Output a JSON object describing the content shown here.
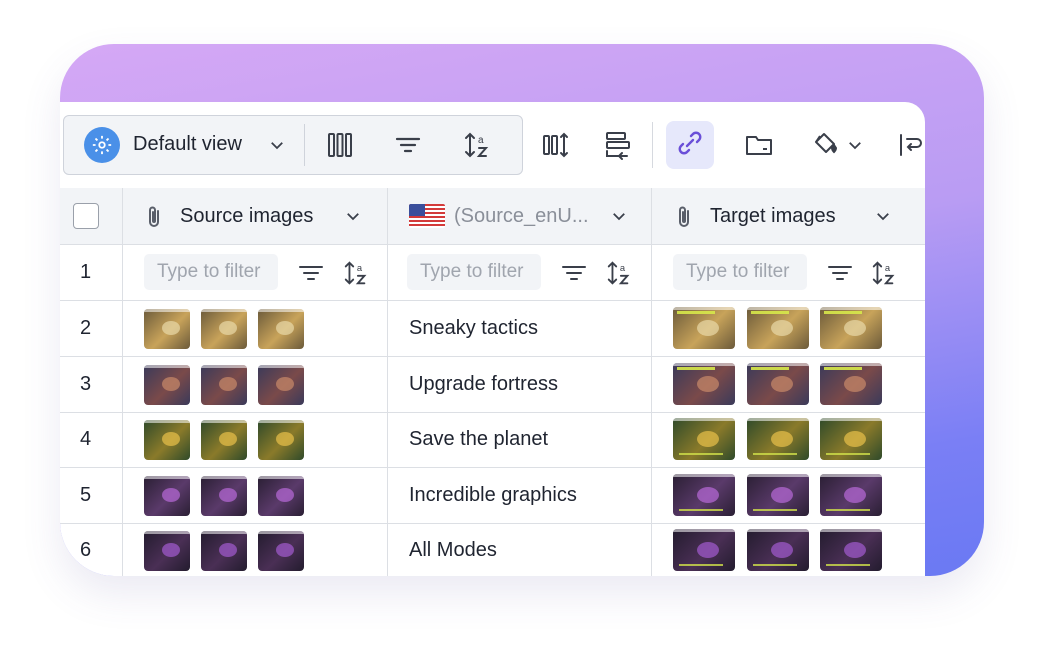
{
  "toolbar": {
    "view_label": "Default view",
    "icons": [
      "gear-icon",
      "chevron-down-icon",
      "columns-icon",
      "filter-icon",
      "sort-az-icon",
      "column-sort-icon",
      "row-group-icon",
      "link-icon",
      "folder-icon",
      "paint-bucket-icon",
      "chevron-down-icon",
      "text-wrap-icon"
    ]
  },
  "table": {
    "columns": [
      {
        "label": "Source images",
        "icon": "paperclip-icon"
      },
      {
        "label": "(Source_enU...",
        "icon": "us-flag-icon"
      },
      {
        "label": "Target images",
        "icon": "paperclip-icon"
      }
    ],
    "filter_placeholder": "Type to filter",
    "filter_row_number": "1",
    "rows": [
      {
        "num": "2",
        "text": "Sneaky tactics"
      },
      {
        "num": "3",
        "text": "Upgrade fortress"
      },
      {
        "num": "4",
        "text": "Save the planet"
      },
      {
        "num": "5",
        "text": "Incredible graphics"
      },
      {
        "num": "6",
        "text": "All Modes"
      }
    ]
  },
  "colors": {
    "gradient_top": "#d5a8f5",
    "gradient_bottom": "#6a79f3",
    "accent_blue": "#4a90e8",
    "link_active_bg": "#e6e8fb",
    "link_icon": "#6a4fd8"
  }
}
